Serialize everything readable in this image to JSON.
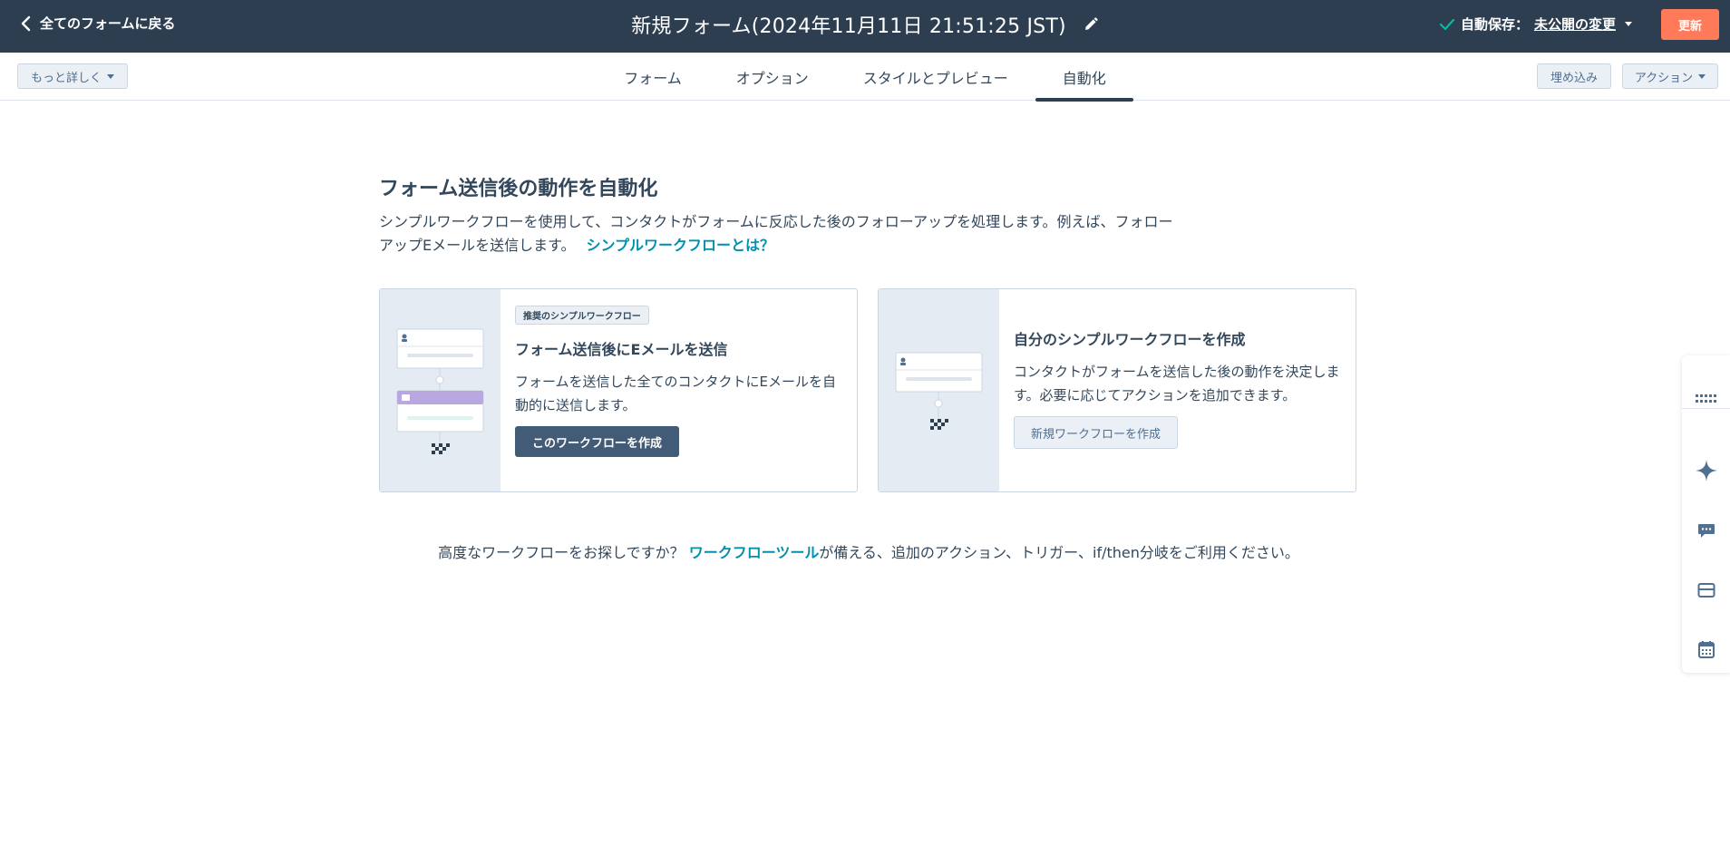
{
  "header": {
    "back_label": "全てのフォームに戻る",
    "form_title": "新規フォーム(2024年11月11日 21:51:25 JST)",
    "autosave_prefix": "自動保存：",
    "autosave_link": "未公開の変更",
    "update_label": "更新"
  },
  "subbar": {
    "more_label": "もっと詳しく",
    "tabs": [
      {
        "label": "フォーム",
        "active": false
      },
      {
        "label": "オプション",
        "active": false
      },
      {
        "label": "スタイルとプレビュー",
        "active": false
      },
      {
        "label": "自動化",
        "active": true
      }
    ],
    "embed_label": "埋め込み",
    "actions_label": "アクション"
  },
  "main": {
    "heading": "フォーム送信後の動作を自動化",
    "description": "シンプルワークフローを使用して、コンタクトがフォームに反応した後のフォローアップを処理します。例えば、フォローアップEメールを送信します。",
    "description_link": "シンプルワークフローとは？",
    "card1": {
      "tag": "推奨のシンプルワークフロー",
      "title": "フォーム送信後にEメールを送信",
      "text": "フォームを送信した全てのコンタクトにEメールを自動的に送信します。",
      "button": "このワークフローを作成"
    },
    "card2": {
      "title": "自分のシンプルワークフローを作成",
      "text": "コンタクトがフォームを送信した後の動作を決定します。必要に応じてアクションを追加できます。",
      "button": "新規ワークフローを作成"
    },
    "footer_prefix": "高度なワークフローをお探しですか？ ",
    "footer_link": "ワークフローツール",
    "footer_suffix": "が備える、追加のアクション、トリガー、if/then分岐をご利用ください。"
  },
  "rail": {
    "icons": [
      "apps-grid-icon",
      "sparkle-icon",
      "chat-icon",
      "inbox-icon",
      "calendar-icon"
    ]
  },
  "colors": {
    "header_bg": "#2d3e50",
    "accent_orange": "#ff7a59",
    "link_teal": "#0091ae",
    "dark_button": "#425b76",
    "illus_bg": "#e5ebf3",
    "purple_card": "#b9a8e0"
  }
}
